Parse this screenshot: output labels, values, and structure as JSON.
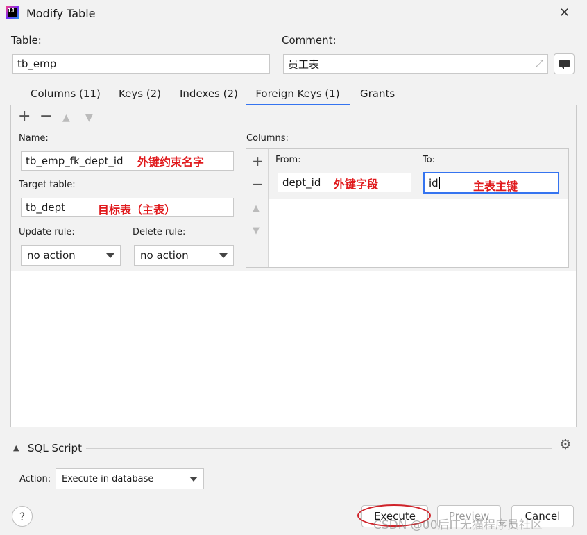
{
  "window": {
    "title": "Modify Table",
    "close_glyph": "✕",
    "app_icon_letters": "IJ"
  },
  "table": {
    "label": "Table:",
    "value": "tb_emp"
  },
  "comment": {
    "label": "Comment:",
    "value": "员工表"
  },
  "tabs": [
    {
      "label": "Columns (11)",
      "active": false
    },
    {
      "label": "Keys (2)",
      "active": false
    },
    {
      "label": "Indexes (2)",
      "active": false
    },
    {
      "label": "Foreign Keys (1)",
      "active": true
    },
    {
      "label": "Grants",
      "active": false
    }
  ],
  "toolbar": {
    "add": "+",
    "remove": "−",
    "up": "▲",
    "down": "▼"
  },
  "fk": {
    "name_label": "Name:",
    "name_value": "tb_emp_fk_dept_id",
    "name_annotation": "外键约束名字",
    "target_label": "Target table:",
    "target_value": "tb_dept",
    "target_annotation": "目标表（主表）",
    "update_label": "Update rule:",
    "update_value": "no action",
    "delete_label": "Delete rule:",
    "delete_value": "no action"
  },
  "columns": {
    "label": "Columns:",
    "from_label": "From:",
    "from_value": "dept_id",
    "from_annotation": "外键字段",
    "to_label": "To:",
    "to_value": "id",
    "to_annotation": "主表主键",
    "tool_add": "+",
    "tool_remove": "−",
    "tool_up": "▲",
    "tool_down": "▼"
  },
  "sql_script": {
    "label": "SQL Script",
    "toggle": "▲",
    "settings_glyph": "⚙"
  },
  "action": {
    "label": "Action:",
    "value": "Execute in database"
  },
  "buttons": {
    "help": "?",
    "execute": "Execute",
    "preview": "Preview",
    "cancel": "Cancel"
  },
  "watermark": "CSDN @00后IT无猫程序员社区",
  "colors": {
    "accent": "#3574f0",
    "annotation": "#e0191c",
    "circle": "#d0232a"
  }
}
